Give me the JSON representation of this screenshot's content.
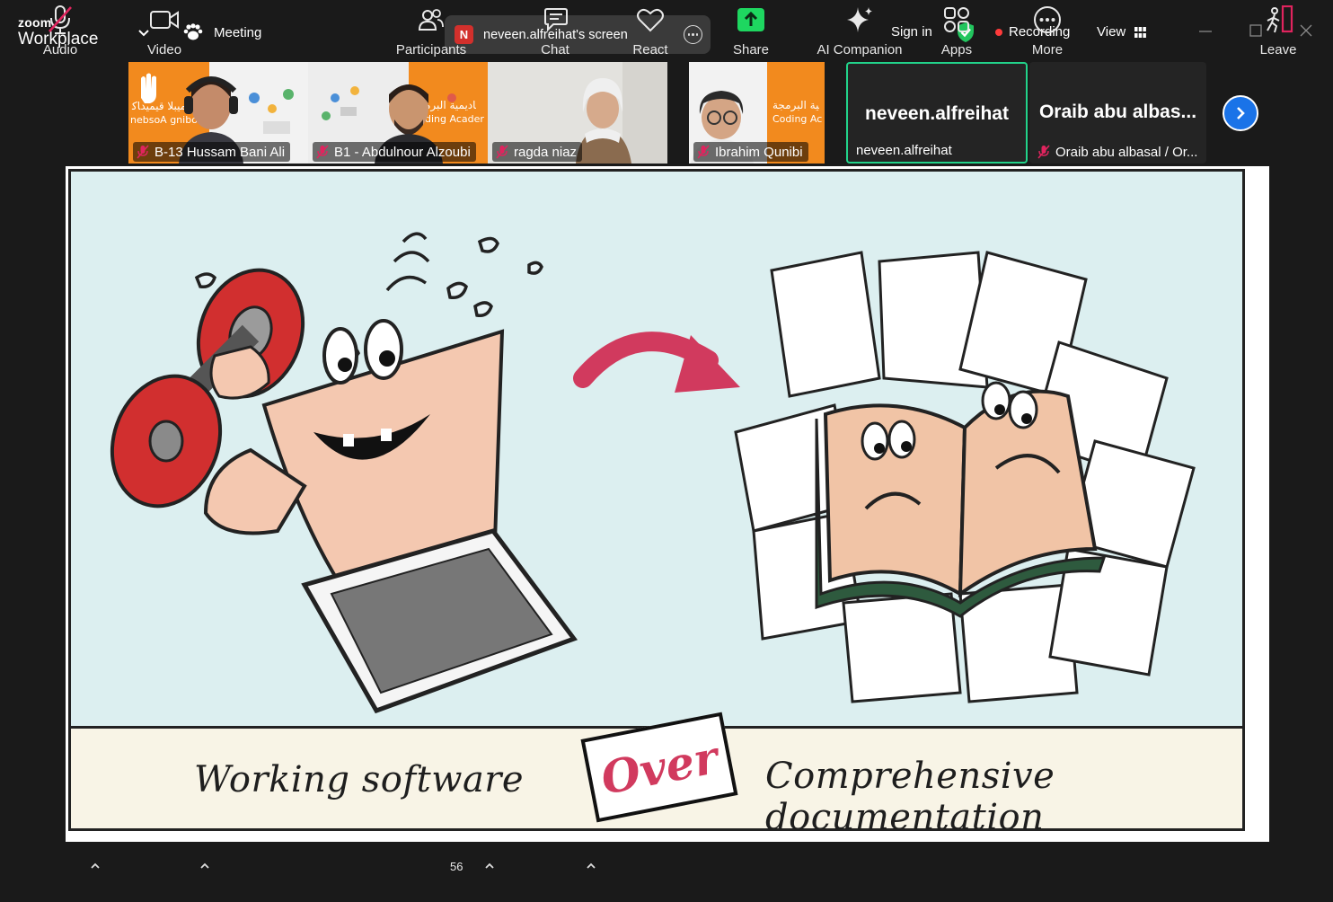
{
  "window": {
    "brand_top": "zoom",
    "brand_bottom": "Workplace",
    "meeting_label": "Meeting",
    "share_initial": "N",
    "share_label": "neveen.alfreihat's screen",
    "sign_in": "Sign in",
    "recording": "Recording",
    "view": "View"
  },
  "gallery": {
    "tiles": [
      {
        "name": "B-13  Hussam Bani Ali",
        "muted": true
      },
      {
        "name": "B1 - Abdulnour Alzoubi",
        "muted": true
      },
      {
        "name": "ragda niaz",
        "muted": true
      },
      {
        "name": "Ibrahim Qunibi",
        "muted": true
      },
      {
        "big": "neveen.alfreihat",
        "name": "neveen.alfreihat",
        "muted": false,
        "active": true
      },
      {
        "big": "Oraib  abu  albas...",
        "name": "Oraib abu albasal / Or...",
        "muted": true
      }
    ],
    "tile_overlay_text": [
      "ﻣﻴﺒﻠﺎ ﻗﻴﻤﻴﺪﺎﻛ",
      "nebsoA gnibo",
      "ﺎﺩﻳﻤﻴﺔ ﺍﻟﺒﺮﻣ",
      "ding Acader",
      "ﻴﺔ ﺍﻟﺒﺮﻣﺠﺔ",
      "Coding Ac"
    ]
  },
  "slide": {
    "left_caption": "Working software",
    "center_word": "Over",
    "right_caption": "Comprehensive documentation",
    "accent": "#d13a5e"
  },
  "toolbar": {
    "audio": "Audio",
    "video": "Video",
    "participants": "Participants",
    "participants_count": "56",
    "chat": "Chat",
    "react": "React",
    "share": "Share",
    "ai_companion": "AI Companion",
    "apps": "Apps",
    "more": "More",
    "leave": "Leave"
  },
  "colors": {
    "share_green": "#1ed760",
    "active_border": "#22d38a",
    "record_red": "#ff3b3b",
    "leave_red": "#e0245e",
    "next_blue": "#1a73e8"
  }
}
